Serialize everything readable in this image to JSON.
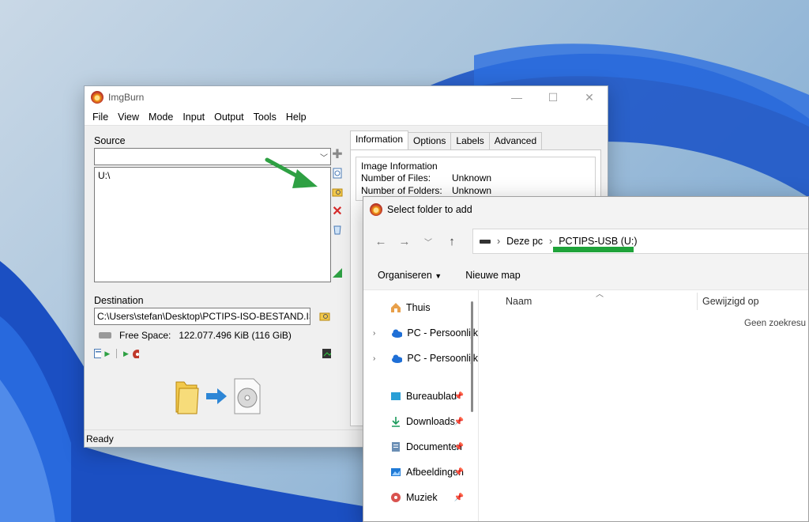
{
  "imgburn": {
    "title": "ImgBurn",
    "menu": [
      "File",
      "View",
      "Mode",
      "Input",
      "Output",
      "Tools",
      "Help"
    ],
    "source_label": "Source",
    "source_combo": "",
    "source_items": [
      "U:\\"
    ],
    "destination_label": "Destination",
    "destination_value": "C:\\Users\\stefan\\Desktop\\PCTIPS-ISO-BESTAND.IS",
    "free_space_label": "Free Space:",
    "free_space_value": "122.077.496 KiB  (116 GiB)",
    "tabs": [
      "Information",
      "Options",
      "Labels",
      "Advanced"
    ],
    "image_info_title": "Image Information",
    "info_rows": [
      {
        "k": "Number of Files:",
        "v": "Unknown"
      },
      {
        "k": "Number of Folders:",
        "v": "Unknown"
      }
    ],
    "status": "Ready"
  },
  "dialog": {
    "title": "Select folder to add",
    "breadcrumb": [
      "Deze pc",
      "PCTIPS-USB (U:)"
    ],
    "cmd_organize": "Organiseren",
    "cmd_new_folder": "Nieuwe map",
    "col_name": "Naam",
    "col_date": "Gewijzigd op",
    "empty_message": "Geen zoekresu",
    "nav_items": [
      {
        "label": "Thuis"
      },
      {
        "label": "PC - Persoonlijk"
      },
      {
        "label": "PC - Persoonlijk"
      },
      {
        "label": "Bureaublad"
      },
      {
        "label": "Downloads"
      },
      {
        "label": "Documenten"
      },
      {
        "label": "Afbeeldingen"
      },
      {
        "label": "Muziek"
      }
    ]
  },
  "colors": {
    "highlight_green": "#1fa33a",
    "arrow_green": "#2ea043"
  }
}
